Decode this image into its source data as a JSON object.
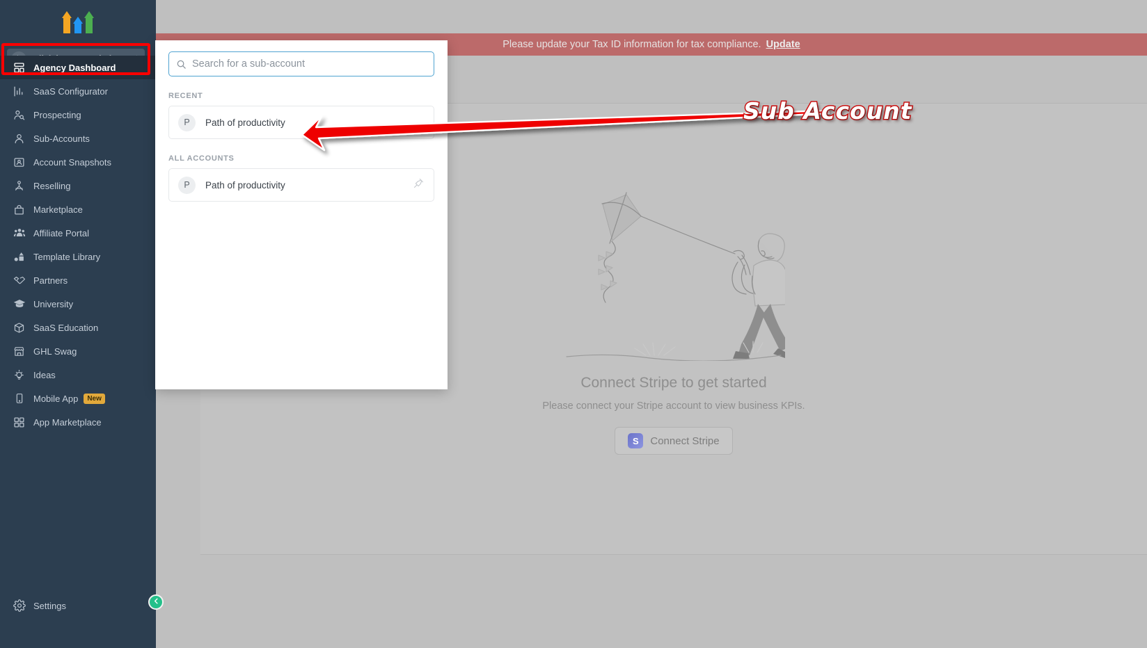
{
  "sidebar": {
    "logo_name": "gohighlevel-arrows-logo",
    "switcher": {
      "label": "Click here to switch",
      "icon": "cursor-click-icon"
    },
    "items": [
      {
        "label": "Agency Dashboard",
        "icon": "dashboard-icon",
        "active": true
      },
      {
        "label": "SaaS Configurator",
        "icon": "bar-chart-icon",
        "active": false
      },
      {
        "label": "Prospecting",
        "icon": "user-search-icon",
        "active": false
      },
      {
        "label": "Sub-Accounts",
        "icon": "user-icon",
        "active": false
      },
      {
        "label": "Account Snapshots",
        "icon": "snapshot-icon",
        "active": false
      },
      {
        "label": "Reselling",
        "icon": "network-icon",
        "active": false
      },
      {
        "label": "Marketplace",
        "icon": "bag-icon",
        "active": false
      },
      {
        "label": "Affiliate Portal",
        "icon": "users-group-icon",
        "active": false
      },
      {
        "label": "Template Library",
        "icon": "shapes-icon",
        "active": false
      },
      {
        "label": "Partners",
        "icon": "handshake-icon",
        "active": false
      },
      {
        "label": "University",
        "icon": "graduation-cap-icon",
        "active": false
      },
      {
        "label": "SaaS Education",
        "icon": "box-icon",
        "active": false
      },
      {
        "label": "GHL Swag",
        "icon": "store-icon",
        "active": false
      },
      {
        "label": "Ideas",
        "icon": "lightbulb-icon",
        "active": false
      },
      {
        "label": "Mobile App",
        "icon": "mobile-icon",
        "active": false,
        "badge": "New"
      },
      {
        "label": "App Marketplace",
        "icon": "grid-icon",
        "active": false
      }
    ],
    "settings": {
      "label": "Settings",
      "icon": "gear-icon"
    },
    "collapse": {
      "icon": "chevron-left-icon"
    }
  },
  "banner": {
    "text": "Please update your Tax ID information for tax compliance.",
    "link_label": "Update",
    "color": "#bc6a6a"
  },
  "account_panel": {
    "search": {
      "placeholder": "Search for a sub-account",
      "value": "",
      "icon": "search-icon"
    },
    "recent_label": "RECENT",
    "all_label": "ALL ACCOUNTS",
    "recent": [
      {
        "initial": "P",
        "name": "Path of productivity"
      }
    ],
    "all_accounts": [
      {
        "initial": "P",
        "name": "Path of productivity",
        "pin_icon": "pin-icon"
      }
    ]
  },
  "main": {
    "empty_state": {
      "illustration": "person-flying-kite-illustration",
      "title": "Connect Stripe to get started",
      "subtitle": "Please connect your Stripe account to view business KPIs.",
      "button_label": "Connect Stripe",
      "button_icon": "stripe-logo-icon"
    }
  },
  "annotation": {
    "label": "Sub Account",
    "arrow": "red-arrow-pointing-left",
    "highlight": "red-rectangle-highlight",
    "color": "#cc1111"
  }
}
